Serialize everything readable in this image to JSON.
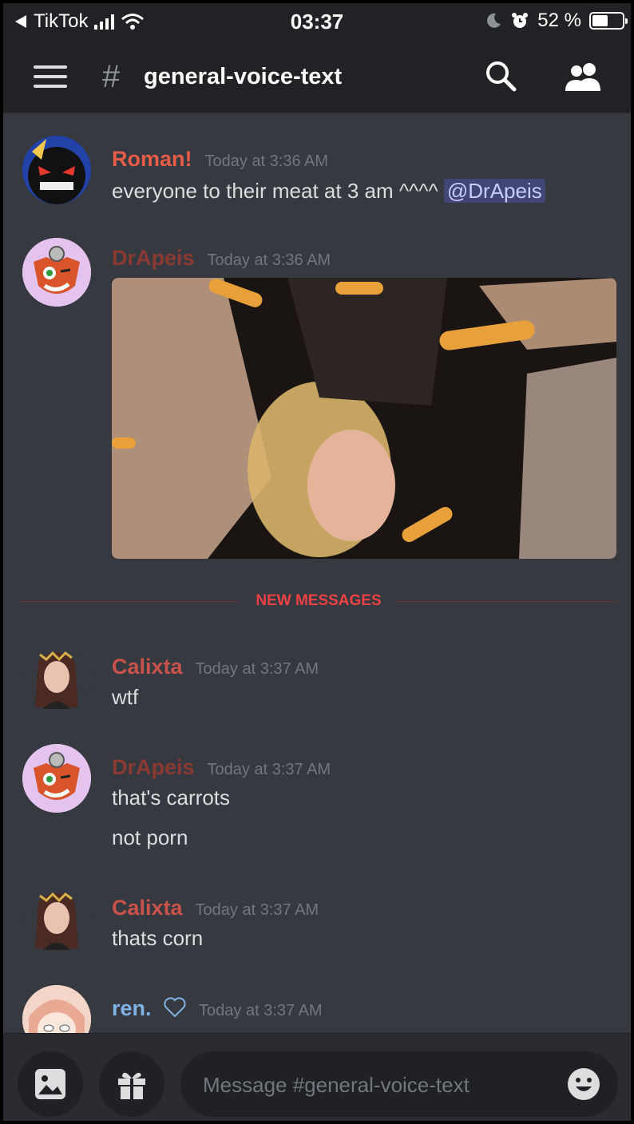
{
  "status_bar": {
    "back_app": "TikTok",
    "time": "03:37",
    "battery": "52 %",
    "battery_level": 0.52
  },
  "header": {
    "channel_name": "general-voice-text"
  },
  "messages": [
    {
      "author": "Roman!",
      "timestamp": "Today at 3:36 AM",
      "author_color": "#e55d49",
      "lines": [
        "everyone to their meat at 3 am ^^^^"
      ],
      "mention": "@DrApeis"
    },
    {
      "author": "DrApeis",
      "timestamp": "Today at 3:36 AM",
      "author_color": "#8b3a33",
      "attachment": "gif-image"
    },
    {
      "author": "Calixta",
      "timestamp": "Today at 3:37 AM",
      "author_color": "#c9534b",
      "lines": [
        "wtf"
      ]
    },
    {
      "author": "DrApeis",
      "timestamp": "Today at 3:37 AM",
      "author_color": "#8b3a33",
      "lines": [
        "that's carrots",
        "not porn"
      ]
    },
    {
      "author": "Calixta",
      "timestamp": "Today at 3:37 AM",
      "author_color": "#c9534b",
      "lines": [
        "thats corn"
      ]
    },
    {
      "author": "ren.",
      "timestamp": "Today at 3:37 AM",
      "author_color": "#7fb3e6",
      "badge_icon": "heart-icon"
    }
  ],
  "divider": {
    "label": "NEW MESSAGES"
  },
  "composer": {
    "placeholder": "Message #general-voice-text"
  },
  "colors": {
    "background": "#36393f",
    "header": "#202225",
    "new_messages": "#ed4245",
    "mention_bg": "#414675"
  }
}
